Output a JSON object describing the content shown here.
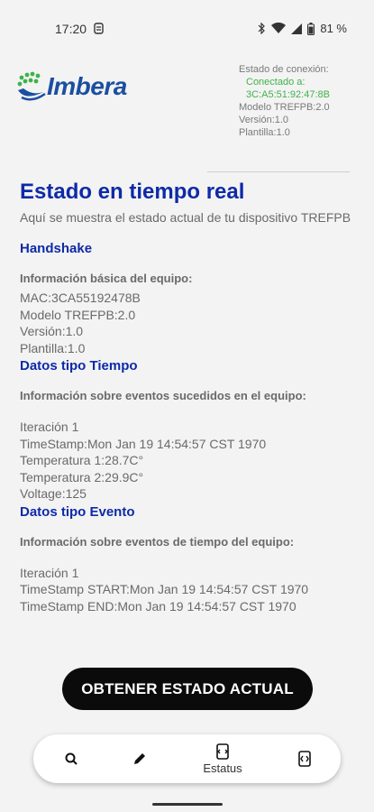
{
  "status_bar": {
    "time": "17:20",
    "battery": "81 %"
  },
  "connection": {
    "heading": "Estado de conexión:",
    "status": "Conectado a:",
    "address": "3C:A5:51:92:47:8B",
    "model": "Modelo TREFPB:2.0",
    "version": "Versión:1.0",
    "template": "Plantilla:1.0"
  },
  "page": {
    "title": "Estado en tiempo real",
    "subtitle": "Aquí se muestra el estado actual de tu dispositivo TREFPB"
  },
  "handshake": {
    "heading": "Handshake",
    "label": "Información básica del equipo:",
    "mac": "MAC:3CA55192478B",
    "model": "Modelo TREFPB:2.0",
    "version": "Versión:1.0",
    "template": "Plantilla:1.0"
  },
  "time_data": {
    "heading": "Datos tipo Tiempo",
    "label": "Información sobre eventos sucedidos en el equipo:",
    "iteration": "Iteración 1",
    "timestamp": "TimeStamp:Mon Jan 19 14:54:57 CST 1970",
    "temp1": "Temperatura 1:28.7C°",
    "temp2": "Temperatura 2:29.9C°",
    "voltage": "Voltage:125"
  },
  "event_data": {
    "heading": "Datos tipo Evento",
    "label": "Información sobre eventos de tiempo del equipo:",
    "iteration": "Iteración 1",
    "ts_start": "TimeStamp START:Mon Jan 19 14:54:57 CST 1970",
    "ts_end": "TimeStamp END:Mon Jan 19 14:54:57 CST 1970"
  },
  "actions": {
    "primary": "OBTENER ESTADO ACTUAL"
  },
  "nav": {
    "status_label": "Estatus"
  },
  "brand": {
    "name": "Imbera",
    "accent": "#0e2aa8",
    "green": "#3fb24a"
  }
}
